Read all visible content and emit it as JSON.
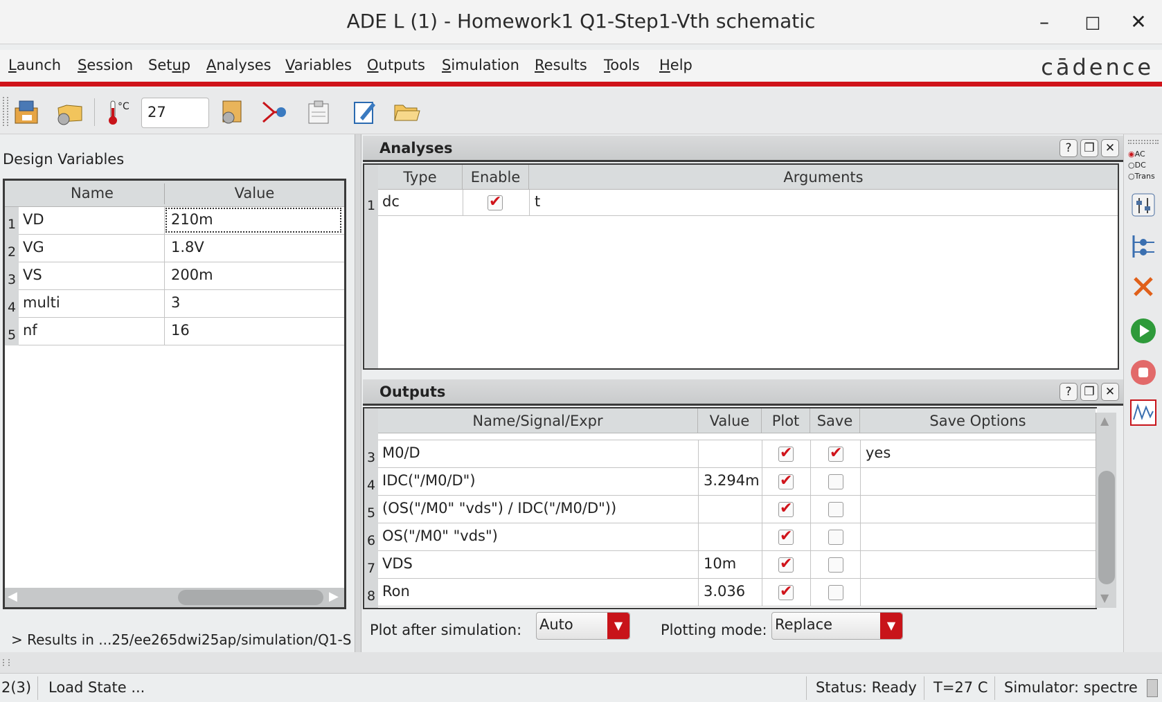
{
  "window": {
    "title": "ADE L (1) - Homework1 Q1-Step1-Vth schematic",
    "minimize_glyph": "–",
    "maximize_glyph": "□",
    "close_glyph": "✕"
  },
  "menu": [
    {
      "label": "Launch",
      "u": "L",
      "rest": "aunch"
    },
    {
      "label": "Session",
      "u": "S",
      "rest": "ession"
    },
    {
      "label": "Setup",
      "pre": "Set",
      "u": "u",
      "rest": "p"
    },
    {
      "label": "Analyses",
      "u": "A",
      "rest": "nalyses"
    },
    {
      "label": "Variables",
      "u": "V",
      "rest": "ariables"
    },
    {
      "label": "Outputs",
      "u": "O",
      "rest": "utputs"
    },
    {
      "label": "Simulation",
      "u": "S",
      "rest": "imulation"
    },
    {
      "label": "Results",
      "u": "R",
      "rest": "esults"
    },
    {
      "label": "Tools",
      "u": "T",
      "rest": "ools"
    },
    {
      "label": "Help",
      "u": "H",
      "rest": "elp"
    }
  ],
  "brand": "cādence",
  "toolbar": {
    "temperature": "27",
    "temp_unit": "°C"
  },
  "design_variables": {
    "title": "Design Variables",
    "headers": [
      "Name",
      "Value"
    ],
    "rows": [
      {
        "n": "1",
        "name": "VD",
        "value": "210m"
      },
      {
        "n": "2",
        "name": "VG",
        "value": "1.8V"
      },
      {
        "n": "3",
        "name": "VS",
        "value": "200m"
      },
      {
        "n": "4",
        "name": "multi",
        "value": "3"
      },
      {
        "n": "5",
        "name": "nf",
        "value": "16"
      }
    ]
  },
  "results_path": "> Results in ...25/ee265dwi25ap/simulation/Q1-S",
  "analyses": {
    "title": "Analyses",
    "headers": [
      "Type",
      "Enable",
      "Arguments"
    ],
    "rows": [
      {
        "n": "1",
        "type": "dc",
        "enabled": true,
        "arguments": "t"
      }
    ]
  },
  "outputs": {
    "title": "Outputs",
    "headers": [
      "Name/Signal/Expr",
      "Value",
      "Plot",
      "Save",
      "Save Options"
    ],
    "rows": [
      {
        "n": "3",
        "name": "M0/D",
        "value": "",
        "plot": true,
        "save": true,
        "save_options": "yes"
      },
      {
        "n": "4",
        "name": "IDC(\"/M0/D\")",
        "value": "3.294m",
        "plot": true,
        "save": false,
        "save_options": ""
      },
      {
        "n": "5",
        "name": "(OS(\"/M0\" \"vds\") / IDC(\"/M0/D\"))",
        "value": "",
        "plot": true,
        "save": false,
        "save_options": ""
      },
      {
        "n": "6",
        "name": "OS(\"/M0\" \"vds\")",
        "value": "",
        "plot": true,
        "save": false,
        "save_options": ""
      },
      {
        "n": "7",
        "name": "VDS",
        "value": "10m",
        "plot": true,
        "save": false,
        "save_options": ""
      },
      {
        "n": "8",
        "name": "Ron",
        "value": "3.036",
        "plot": true,
        "save": false,
        "save_options": ""
      }
    ],
    "plot_after_label": "Plot after simulation:",
    "plot_after_value": "Auto",
    "plotting_mode_label": "Plotting mode:",
    "plotting_mode_value": "Replace"
  },
  "dock_buttons": {
    "help": "?",
    "float": "❐",
    "close": "✕"
  },
  "sidebar": {
    "radio_ac": "AC",
    "radio_dc": "DC",
    "radio_trans": "Trans"
  },
  "status": {
    "left": "2(3)",
    "load": "Load State ...",
    "status": "Status: Ready",
    "temp": "T=27  C",
    "simulator": "Simulator: spectre"
  },
  "colors": {
    "accent_red": "#d0141b",
    "run_green": "#2e9a3a"
  }
}
